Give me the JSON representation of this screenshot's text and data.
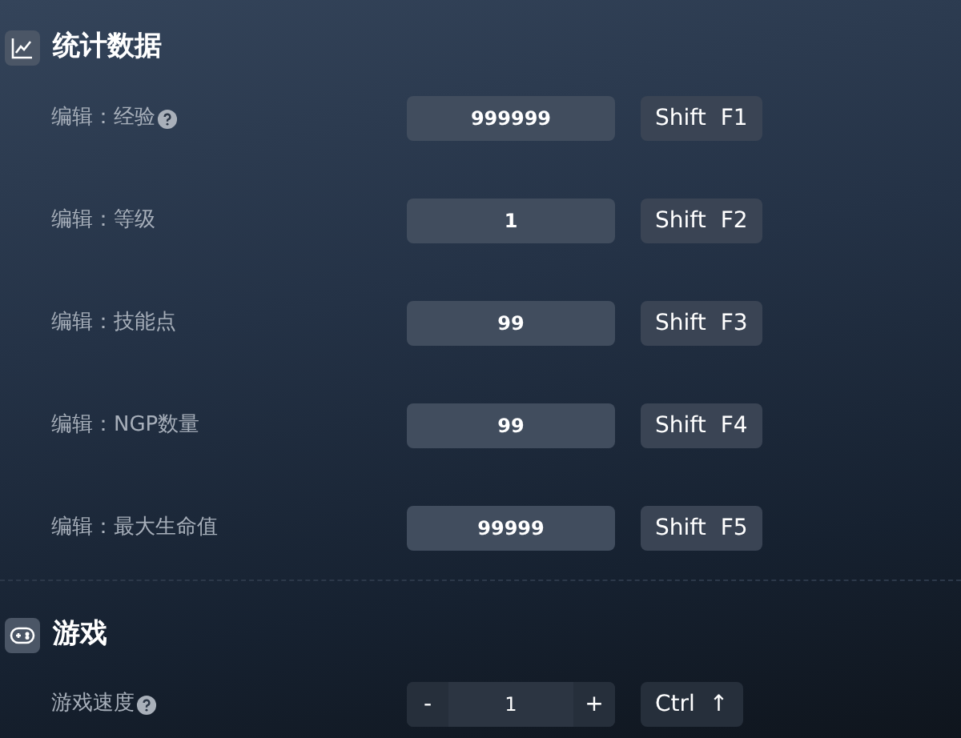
{
  "sections": [
    {
      "title": "统计数据",
      "rows": [
        {
          "kind": "input",
          "label": "编辑：经验",
          "help": true,
          "value": "999999",
          "hotkey": [
            "Shift",
            "F1"
          ]
        },
        {
          "kind": "input",
          "label": "编辑：等级",
          "help": false,
          "value": "1",
          "hotkey": [
            "Shift",
            "F2"
          ]
        },
        {
          "kind": "input",
          "label": "编辑：技能点",
          "help": false,
          "value": "99",
          "hotkey": [
            "Shift",
            "F3"
          ]
        },
        {
          "kind": "input",
          "label": "编辑：NGP数量",
          "help": false,
          "value": "99",
          "hotkey": [
            "Shift",
            "F4"
          ]
        },
        {
          "kind": "input",
          "label": "编辑：最大生命值",
          "help": false,
          "value": "99999",
          "hotkey": [
            "Shift",
            "F5"
          ]
        }
      ]
    },
    {
      "title": "游戏",
      "rows": [
        {
          "kind": "stepper",
          "label": "游戏速度",
          "help": true,
          "minus": "-",
          "value": "1",
          "plus": "+",
          "hotkey": [
            "Ctrl",
            "↑"
          ]
        }
      ]
    }
  ]
}
